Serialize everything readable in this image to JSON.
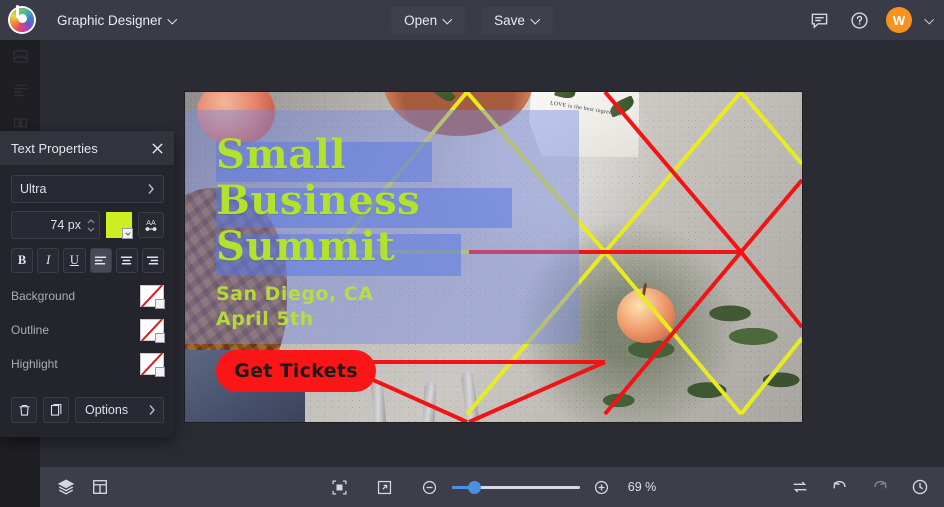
{
  "app": {
    "logo_icon": "color-wheel-logo",
    "document_title": "Graphic Designer"
  },
  "topbar": {
    "open_label": "Open",
    "save_label": "Save",
    "feedback_icon": "comment-icon",
    "help_icon": "help-circle-icon",
    "avatar_initial": "W"
  },
  "left_rail": {
    "items": [
      {
        "icon": "image-tool-icon"
      },
      {
        "icon": "text-tool-icon"
      },
      {
        "icon": "shapes-tool-icon"
      }
    ]
  },
  "panel": {
    "title": "Text Properties",
    "close_icon": "close-icon",
    "font_family": "Ultra",
    "font_family_chevron": "chevron-right-icon",
    "font_size": "74 px",
    "color_swatch": "#ccee22",
    "text_effects_icon": "AA",
    "format": {
      "bold": "B",
      "italic": "I",
      "underline": "U",
      "align_left_icon": "align-left-icon",
      "align_center_icon": "align-center-icon",
      "align_right_icon": "align-right-icon"
    },
    "properties": [
      {
        "label": "Background",
        "value": "none"
      },
      {
        "label": "Outline",
        "value": "none"
      },
      {
        "label": "Highlight",
        "value": "none"
      }
    ],
    "delete_icon": "trash-icon",
    "duplicate_icon": "duplicate-icon",
    "options_label": "Options",
    "options_chevron": "chevron-right-icon"
  },
  "canvas": {
    "artwork": {
      "headline_lines": [
        "Small",
        "Business",
        "Summit"
      ],
      "subtitle_lines": [
        "San Diego, CA",
        "April 5th"
      ],
      "cta_label": "Get Tickets",
      "napkin_text": "LOVE is the best ingredient",
      "headline_color": "#b2e22c",
      "highlight_color": "#5a78e6",
      "cta_color": "#fa1616",
      "triangle_colors": [
        "#e8ec1e",
        "#f21414"
      ]
    }
  },
  "bottombar": {
    "layers_icon": "layers-icon",
    "page-layout_icon": "page-layout-icon",
    "fit-screen_icon": "fit-to-screen-icon",
    "fullscreen_icon": "expand-icon",
    "zoom_out_icon": "minus-circle-icon",
    "zoom_in_icon": "plus-circle-icon",
    "zoom_value": "69 %",
    "compare_icon": "compare-icon",
    "undo_icon": "undo-icon",
    "redo_icon": "redo-icon",
    "history_icon": "history-clock-icon"
  }
}
